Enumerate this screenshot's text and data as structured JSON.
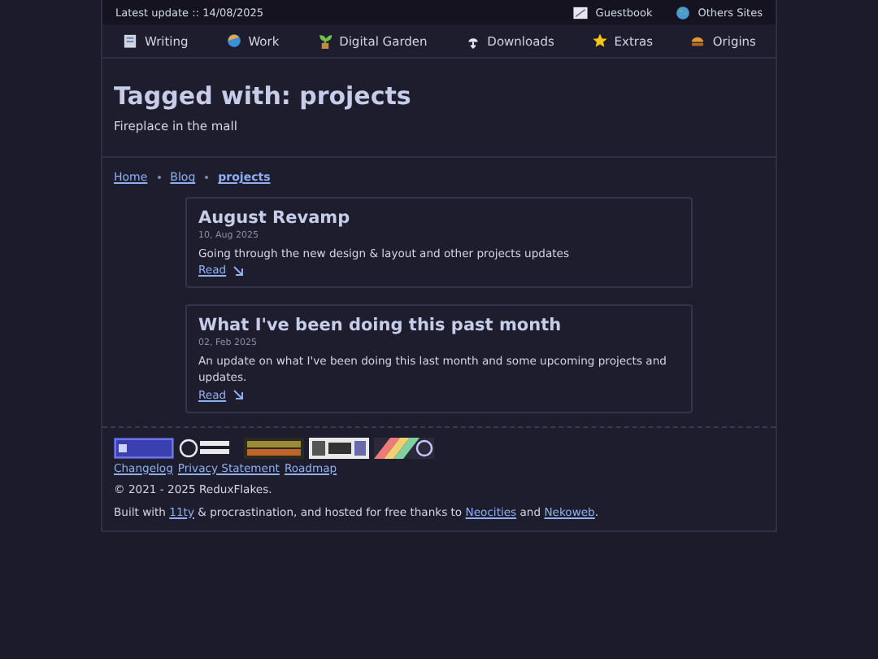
{
  "top_bar": {
    "latest_update": "Latest update :: 14/08/2025",
    "links": [
      {
        "label": "Guestbook"
      },
      {
        "label": "Others Sites"
      }
    ]
  },
  "nav": {
    "items": [
      {
        "label": "Writing"
      },
      {
        "label": "Work"
      },
      {
        "label": "Digital Garden"
      },
      {
        "label": "Downloads"
      },
      {
        "label": "Extras"
      },
      {
        "label": "Origins"
      }
    ]
  },
  "header": {
    "title": "Tagged with: projects",
    "subtitle": "Fireplace in the mall"
  },
  "breadcrumb": [
    {
      "label": "Home",
      "current": false
    },
    {
      "label": "Blog",
      "current": false
    },
    {
      "label": "projects",
      "current": true
    }
  ],
  "posts": [
    {
      "title": "August Revamp",
      "date": "10, Aug 2025",
      "summary": "Going through the new design & layout and other projects updates",
      "link": "Read"
    },
    {
      "title": "What I've been doing this past month",
      "date": "02, Feb 2025",
      "summary": "An update on what I've been doing this last month and some upcoming projects and updates.",
      "link": "Read"
    }
  ],
  "footer": {
    "links": [
      "Changelog",
      "Privacy Statement",
      "Roadmap"
    ],
    "copyright": "© 2021 - 2025 ReduxFlakes.",
    "built_with": {
      "texts": [
        "Built with ",
        " & procrastination, and hosted for free thanks to ",
        " and ",
        "."
      ],
      "links": [
        "11ty",
        "Neocities",
        "Nekoweb"
      ]
    }
  }
}
